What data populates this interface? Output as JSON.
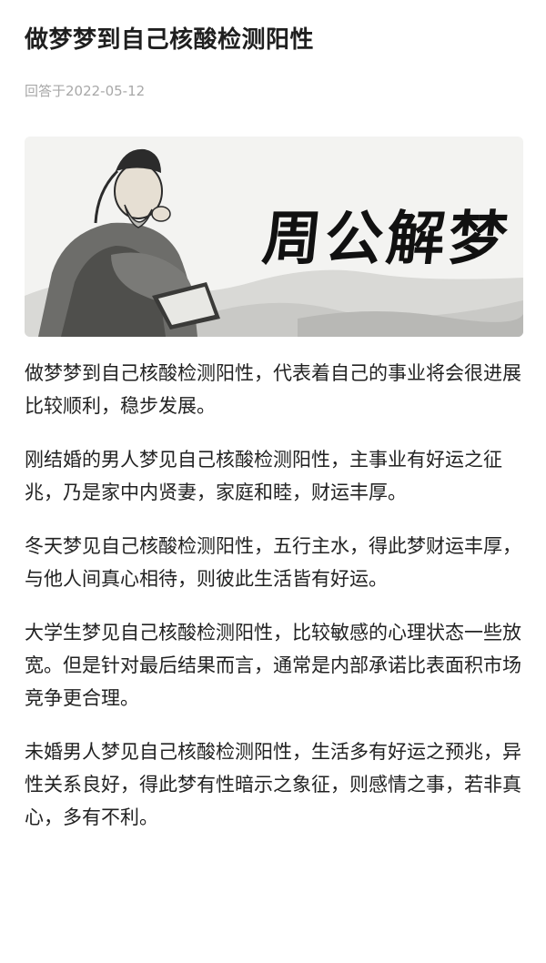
{
  "article": {
    "title": "做梦梦到自己核酸检测阳性",
    "answered_date": "回答于2022-05-12"
  },
  "banner": {
    "calligraphy_text": "周公解梦"
  },
  "paragraphs": [
    "做梦梦到自己核酸检测阳性，代表着自己的事业将会很进展比较顺利，稳步发展。",
    "刚结婚的男人梦见自己核酸检测阳性，主事业有好运之征兆，乃是家中内贤妻，家庭和睦，财运丰厚。",
    "冬天梦见自己核酸检测阳性，五行主水，得此梦财运丰厚，与他人间真心相待，则彼此生活皆有好运。",
    "大学生梦见自己核酸检测阳性，比较敏感的心理状态一些放宽。但是针对最后结果而言，通常是内部承诺比表面积市场竞争更合理。",
    "未婚男人梦见自己核酸检测阳性，生活多有好运之预兆，异性关系良好，得此梦有性暗示之象征，则感情之事，若非真心，多有不利。"
  ]
}
